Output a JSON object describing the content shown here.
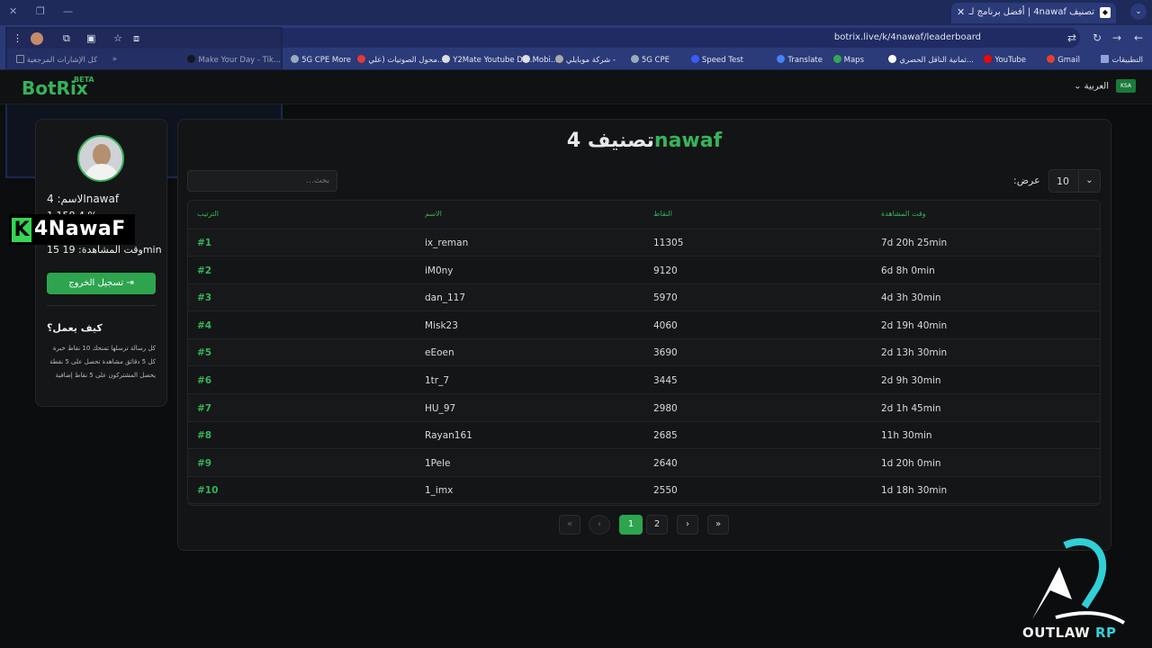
{
  "browser": {
    "tab_title": "تصنيف 4nawaf | أفضل برنامج لـ",
    "url": "botrix.live/k/4nawaf/leaderboard",
    "bookmarks": [
      "التطبيقات",
      "Gmail",
      "YouTube",
      "ثمانية الناقل الحصري...",
      "Maps",
      "Translate",
      "Speed Test",
      "5G CPE",
      "شركة موبايلي -",
      "Mobi...",
      "Y2Mate Youtube Do...",
      "محول الصوتيات (علي...",
      "5G CPE More",
      "Make Your Day - Tik...",
      "كل الإشارات المرجعية"
    ]
  },
  "header": {
    "logo": "BotRix",
    "beta": "BETA",
    "language": "العربية",
    "flag_label": "KSA"
  },
  "profile": {
    "name": "الاسم: 4nawaf",
    "cut_line": "1,158.4 %",
    "watch_time": "وقت المشاهدة: 19 15min",
    "logout_label": "تسجيل الخروج",
    "how_title": "كيف يعمل؟",
    "how_lines": [
      "كل رسالة ترسلها تمنحك 10 نقاط خبرة",
      "كل 5 دقائق مشاهدة تحصل على 5 نقطة",
      "يحصل المشتركون على 5 نقاط إضافية"
    ]
  },
  "overlay_brand": {
    "letter": "K",
    "text": "4NawaF"
  },
  "page": {
    "title_prefix": "تصنيف",
    "title_number": "4",
    "title_name": "nawaf",
    "search_placeholder": "بحث...",
    "show_label": "عرض:",
    "show_value": "10"
  },
  "table": {
    "headers": [
      "الترتيب",
      "الاسم",
      "النقاط",
      "وقت المشاهدة"
    ],
    "rows": [
      {
        "rank": "#1",
        "name": "ix_reman",
        "points": "11305",
        "watch": "7d 20h 25min"
      },
      {
        "rank": "#2",
        "name": "iM0ny",
        "points": "9120",
        "watch": "6d 8h 0min"
      },
      {
        "rank": "#3",
        "name": "dan_117",
        "points": "5970",
        "watch": "4d 3h 30min"
      },
      {
        "rank": "#4",
        "name": "Misk23",
        "points": "4060",
        "watch": "2d 19h 40min"
      },
      {
        "rank": "#5",
        "name": "eEoen",
        "points": "3690",
        "watch": "2d 13h 30min"
      },
      {
        "rank": "#6",
        "name": "1tr_7",
        "points": "3445",
        "watch": "2d 9h 30min"
      },
      {
        "rank": "#7",
        "name": "HU_97",
        "points": "2980",
        "watch": "2d 1h 45min"
      },
      {
        "rank": "#8",
        "name": "Rayan161",
        "points": "2685",
        "watch": "11h 30min"
      },
      {
        "rank": "#9",
        "name": "1Pele",
        "points": "2640",
        "watch": "1d 20h 0min"
      },
      {
        "rank": "#10",
        "name": "1_imx",
        "points": "2550",
        "watch": "1d 18h 30min"
      }
    ]
  },
  "pagination": {
    "first": "«",
    "prev": "‹",
    "pages": [
      "1",
      "2"
    ],
    "next": "›",
    "last": "»",
    "current": "1"
  },
  "watermark": {
    "text1": "OUTLAW",
    "text2": "RP"
  },
  "colors": {
    "accent": "#36b35a",
    "button": "#2ea44f",
    "watermark": "#2fd0d6"
  }
}
